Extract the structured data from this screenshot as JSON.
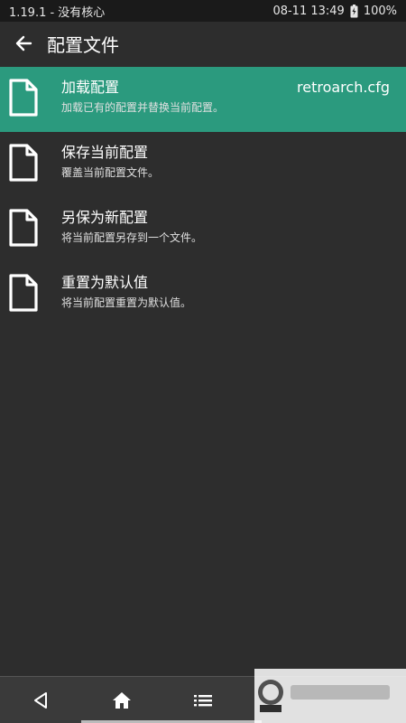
{
  "status": {
    "left": "1.19.1 - 没有核心",
    "time": "08-11 13:49",
    "battery": "100%"
  },
  "header": {
    "title": "配置文件"
  },
  "items": [
    {
      "title": "加载配置",
      "desc": "加载已有的配置并替换当前配置。",
      "value": "retroarch.cfg",
      "selected": true
    },
    {
      "title": "保存当前配置",
      "desc": "覆盖当前配置文件。",
      "value": ""
    },
    {
      "title": "另保为新配置",
      "desc": "将当前配置另存到一个文件。",
      "value": ""
    },
    {
      "title": "重置为默认值",
      "desc": "将当前配置重置为默认值。",
      "value": ""
    }
  ],
  "colors": {
    "background": "#2d2d2d",
    "selected": "#2b9a7e",
    "status_bar": "#1a1a1a"
  },
  "nav": {
    "icons": [
      "back-triangle-icon",
      "home-icon",
      "menu-list-icon",
      "watermark-logo"
    ]
  }
}
